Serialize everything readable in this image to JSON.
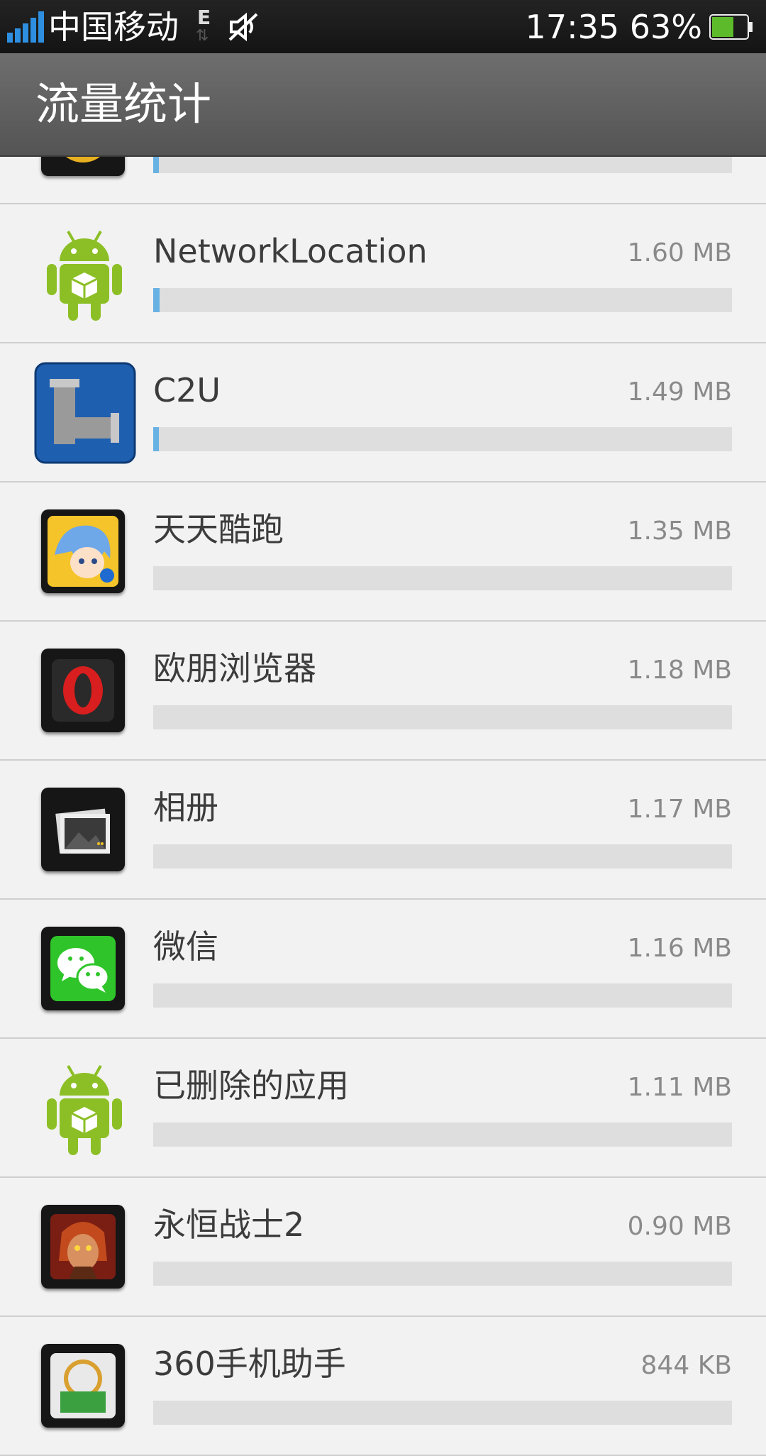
{
  "status_bar": {
    "carrier": "中国移动",
    "network_type": "E",
    "time": "17:35",
    "battery_percent": "63%",
    "battery_level": 0.63,
    "icons": [
      "signal-icon",
      "data-arrows-icon",
      "mute-icon",
      "battery-icon"
    ]
  },
  "header": {
    "title": "流量统计"
  },
  "apps": [
    {
      "name": "",
      "size": "",
      "usage_fraction": 0.01,
      "icon": "green-globe-icon"
    },
    {
      "name": "NetworkLocation",
      "size": "1.60 MB",
      "usage_fraction": 0.011,
      "icon": "android-icon"
    },
    {
      "name": "C2U",
      "size": "1.49 MB",
      "usage_fraction": 0.01,
      "icon": "pipe-icon"
    },
    {
      "name": "天天酷跑",
      "size": "1.35 MB",
      "usage_fraction": 0.0,
      "icon": "game-character-icon"
    },
    {
      "name": "欧朋浏览器",
      "size": "1.18 MB",
      "usage_fraction": 0.0,
      "icon": "opera-icon"
    },
    {
      "name": "相册",
      "size": "1.17 MB",
      "usage_fraction": 0.0,
      "icon": "gallery-icon"
    },
    {
      "name": "微信",
      "size": "1.16 MB",
      "usage_fraction": 0.0,
      "icon": "wechat-icon"
    },
    {
      "name": "已删除的应用",
      "size": "1.11 MB",
      "usage_fraction": 0.0,
      "icon": "android-icon"
    },
    {
      "name": "永恒战士2",
      "size": "0.90 MB",
      "usage_fraction": 0.0,
      "icon": "warrior-icon"
    },
    {
      "name": "360手机助手",
      "size": "844 KB",
      "usage_fraction": 0.0,
      "icon": "360-assistant-icon"
    }
  ],
  "colors": {
    "bar_fill": "#68b1e3",
    "bar_track": "#dedede",
    "background": "#f2f2f2"
  }
}
